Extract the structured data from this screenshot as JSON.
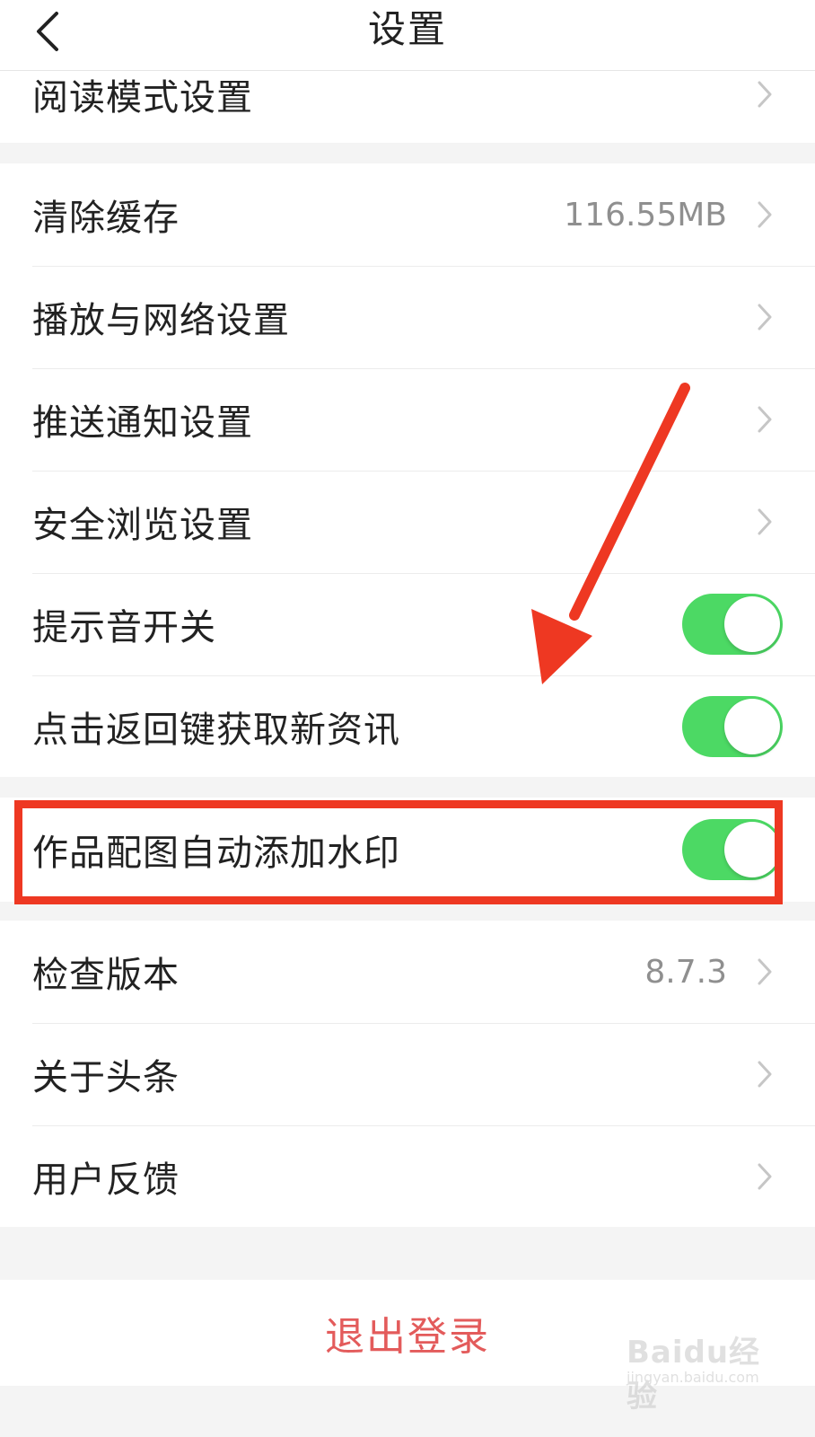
{
  "nav": {
    "title": "设置",
    "back_icon": "chevron-left-icon"
  },
  "groups": {
    "reading": {
      "label": "阅读模式设置"
    },
    "general": {
      "clear_cache": {
        "label": "清除缓存",
        "value": "116.55MB"
      },
      "playback_network": {
        "label": "播放与网络设置"
      },
      "push_notification": {
        "label": "推送通知设置"
      },
      "safe_browsing": {
        "label": "安全浏览设置"
      },
      "sound_toggle": {
        "label": "提示音开关",
        "on": true
      },
      "back_refresh_toggle": {
        "label": "点击返回键获取新资讯",
        "on": true
      }
    },
    "watermark": {
      "watermark_toggle": {
        "label": "作品配图自动添加水印",
        "on": true
      }
    },
    "about": {
      "check_version": {
        "label": "检查版本",
        "value": "8.7.3"
      },
      "about_toutiao": {
        "label": "关于头条"
      },
      "feedback": {
        "label": "用户反馈"
      }
    }
  },
  "logout": {
    "label": "退出登录"
  },
  "annotations": {
    "highlight_color": "#ee3822",
    "arrow_color": "#ee3822"
  },
  "watermark_overlay": {
    "logo": "Baidu经验",
    "url": "jingyan.baidu.com"
  },
  "colors": {
    "toggle_on": "#4cd964",
    "logout_text": "#e35b5b",
    "value_text": "#8f8f8f",
    "background": "#f4f4f4"
  }
}
